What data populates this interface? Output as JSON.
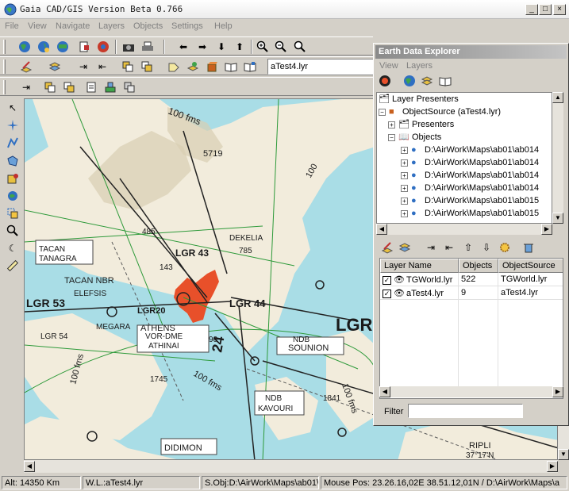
{
  "window": {
    "title": "Gaia CAD/GIS Version Beta 0.766",
    "minimize": "_",
    "maximize": "□",
    "close": "×"
  },
  "menu": [
    "File",
    "View",
    "Navigate",
    "Layers",
    "Objects",
    "Settings",
    "Help"
  ],
  "layer_combo": {
    "value": "aTest4.lyr"
  },
  "explorer": {
    "title": "Earth Data Explorer",
    "menu": [
      "View",
      "Layers"
    ],
    "tree": [
      {
        "label": "Layer Presenters",
        "indent": 0
      },
      {
        "label": "ObjectSource (aTest4.lyr)",
        "indent": 0
      },
      {
        "label": "Presenters",
        "indent": 1
      },
      {
        "label": "Objects",
        "indent": 1
      },
      {
        "label": "D:\\AirWork\\Maps\\ab01\\ab014",
        "indent": 2
      },
      {
        "label": "D:\\AirWork\\Maps\\ab01\\ab014",
        "indent": 2
      },
      {
        "label": "D:\\AirWork\\Maps\\ab01\\ab014",
        "indent": 2
      },
      {
        "label": "D:\\AirWork\\Maps\\ab01\\ab014",
        "indent": 2
      },
      {
        "label": "D:\\AirWork\\Maps\\ab01\\ab015",
        "indent": 2
      },
      {
        "label": "D:\\AirWork\\Maps\\ab01\\ab015",
        "indent": 2
      }
    ],
    "grid": {
      "columns": [
        "Layer Name",
        "Objects",
        "ObjectSource"
      ],
      "rows": [
        {
          "name": "TGWorld.lyr",
          "objects": "522",
          "source": "TGWorld.lyr",
          "checked": true
        },
        {
          "name": "aTest4.lyr",
          "objects": "9",
          "source": "aTest4.lyr",
          "checked": true
        }
      ]
    },
    "filter_label": "Filter",
    "filter_value": ""
  },
  "map_labels": {
    "fms1": "100 fms",
    "fms2": "100 fms",
    "fms3": "100 fms",
    "fms4": "100 fms",
    "n5719": "5719",
    "n485": "485",
    "n143": "143",
    "n785": "785",
    "n90": "90",
    "n1745": "1745",
    "n1841": "1841",
    "n100": "100",
    "tacan_tanagra1": "TACAN",
    "tacan_tanagra2": "TANAGRA",
    "tacan_nbr": "TACAN NBR",
    "elefsis": "ELEFSIS",
    "dekelia": "DEKELIA",
    "lgr43": "LGR 43",
    "lgr53": "LGR 53",
    "lgr20": "LGR20",
    "lgr44": "LGR 44",
    "lgr54": "LGR 54",
    "lgr_big": "LGR",
    "megara": "MEGARA",
    "athens": "ATHENS",
    "vor_dme": "VOR-DME",
    "athinai": "ATHINAI",
    "ndb1": "NDB",
    "sounion": "SOUNION",
    "ndb2": "NDB",
    "kavouri": "KAVOURI",
    "didimon": "DIDIMON",
    "ripli": "RIPLI",
    "coord": "37°17'N",
    "n24": "24"
  },
  "status": {
    "alt": "Alt: 14350 Km",
    "wl": "W.L.:aTest4.lyr",
    "sobj": "S.Obj:D:\\AirWork\\Maps\\ab01\\",
    "mouse": "Mouse Pos: 23.26.16,02E 38.51.12,01N / D:\\AirWork\\Maps\\a"
  },
  "colors": {
    "sea": "#a9dde6",
    "land": "#f2ecdc",
    "city": "#e8502a",
    "explorer_title": "#8a8a8a"
  }
}
